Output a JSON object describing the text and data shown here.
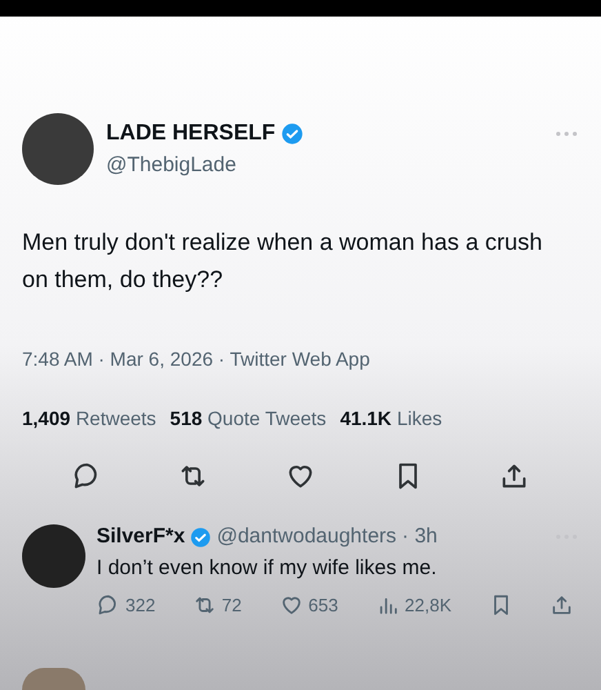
{
  "tweet": {
    "author": {
      "name": "LADE HERSELF",
      "verified": true,
      "handle": "@ThebigLade"
    },
    "text": "Men truly don't realize when a woman has a crush on them, do they??",
    "meta": "7:48 AM · Mar 6, 2026 · Twitter Web App",
    "stats": [
      {
        "count": "1,409",
        "label": "Retweets"
      },
      {
        "count": "518",
        "label": "Quote Tweets"
      },
      {
        "count": "41.1K",
        "label": "Likes"
      }
    ],
    "actions": [
      {
        "kind": "reply"
      },
      {
        "kind": "retweet"
      },
      {
        "kind": "like"
      },
      {
        "kind": "bookmark"
      },
      {
        "kind": "share"
      }
    ]
  },
  "reply": {
    "author": {
      "name": "SilverF*x",
      "verified": true,
      "handle": "@dantwodaughters",
      "time": "· 3h"
    },
    "text": "I don’t even know if my wife likes me.",
    "actions": [
      {
        "kind": "reply",
        "count": "322"
      },
      {
        "kind": "retweet",
        "count": "72"
      },
      {
        "kind": "like",
        "count": "653"
      },
      {
        "kind": "views",
        "count": "22,8K"
      },
      {
        "kind": "bookmark"
      },
      {
        "kind": "share"
      }
    ]
  }
}
